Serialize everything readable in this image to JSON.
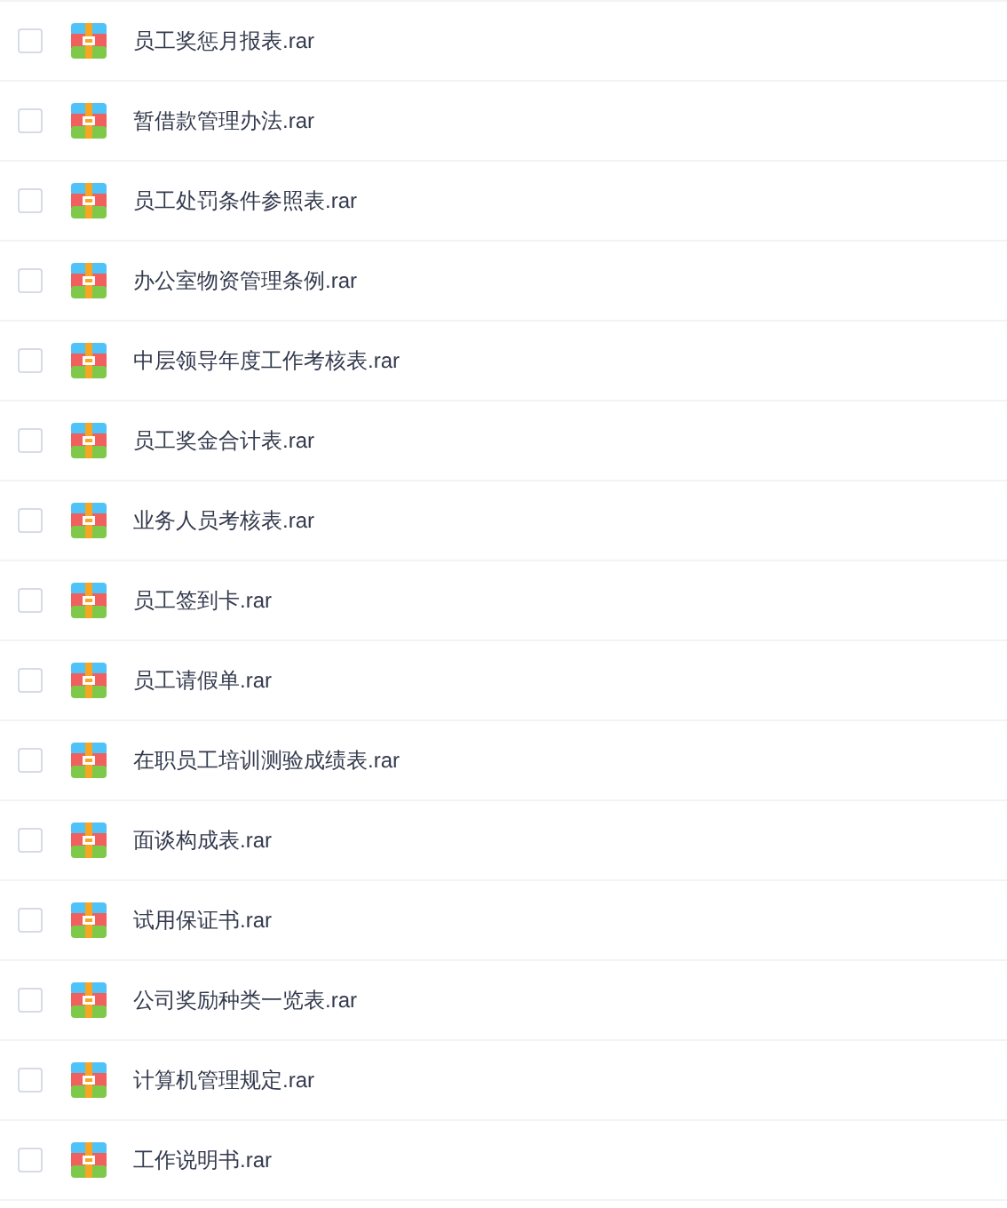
{
  "files": [
    {
      "name": "员工奖惩月报表.rar",
      "checked": false
    },
    {
      "name": "暂借款管理办法.rar",
      "checked": false
    },
    {
      "name": "员工处罚条件参照表.rar",
      "checked": false
    },
    {
      "name": "办公室物资管理条例.rar",
      "checked": false
    },
    {
      "name": "中层领导年度工作考核表.rar",
      "checked": false
    },
    {
      "name": "员工奖金合计表.rar",
      "checked": false
    },
    {
      "name": "业务人员考核表.rar",
      "checked": false
    },
    {
      "name": "员工签到卡.rar",
      "checked": false
    },
    {
      "name": "员工请假单.rar",
      "checked": false
    },
    {
      "name": "在职员工培训测验成绩表.rar",
      "checked": false
    },
    {
      "name": "面谈构成表.rar",
      "checked": false
    },
    {
      "name": "试用保证书.rar",
      "checked": false
    },
    {
      "name": "公司奖励种类一览表.rar",
      "checked": false
    },
    {
      "name": "计算机管理规定.rar",
      "checked": false
    },
    {
      "name": "工作说明书.rar",
      "checked": false
    }
  ]
}
